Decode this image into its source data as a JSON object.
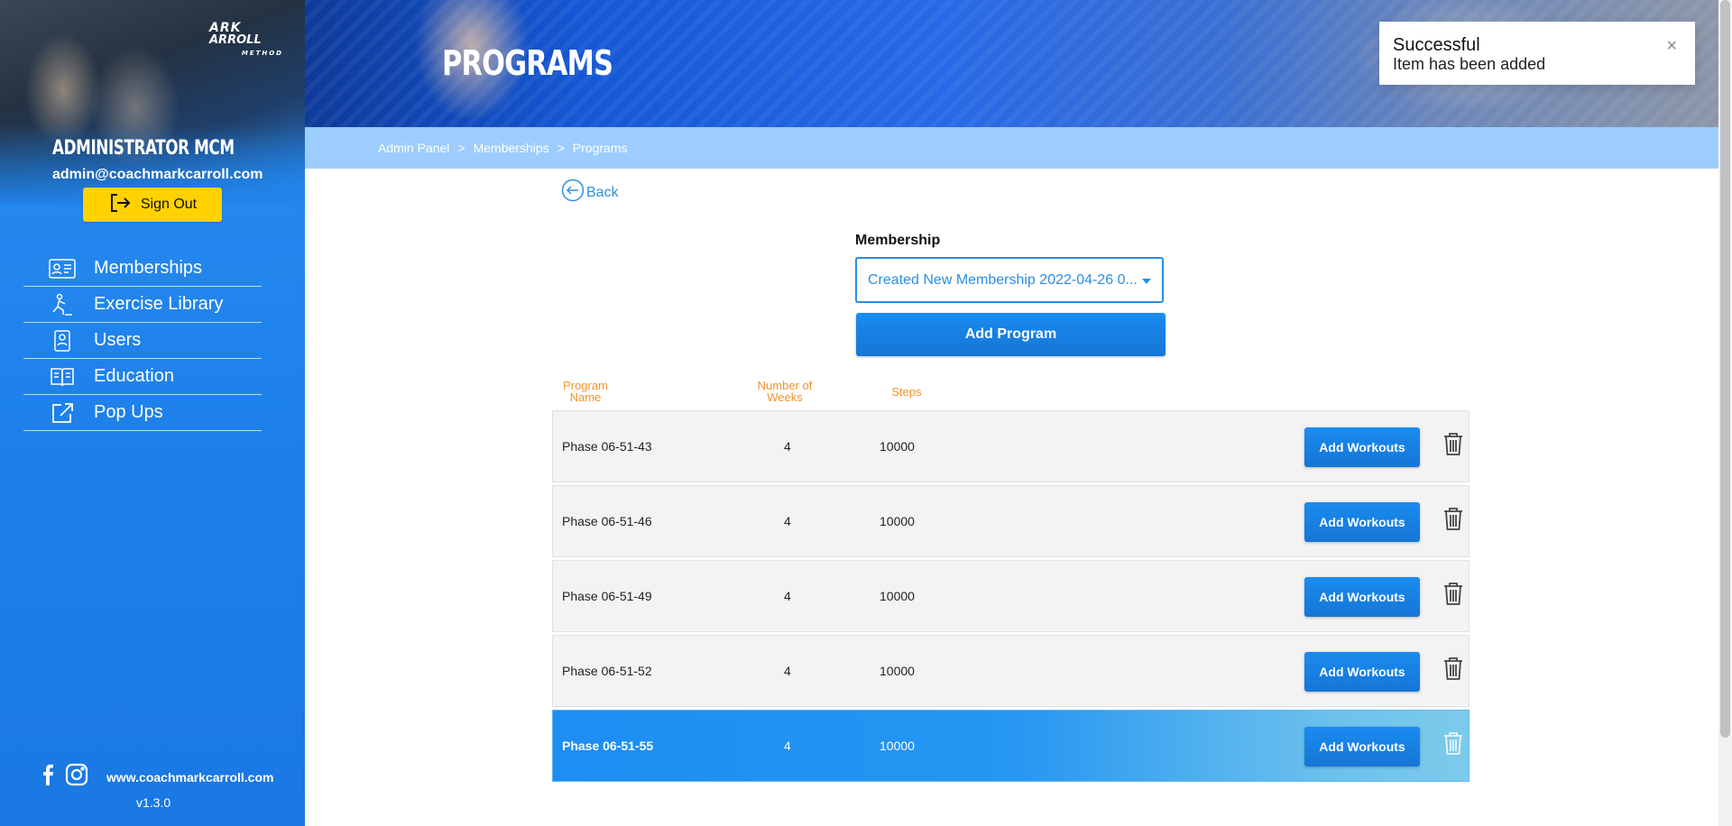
{
  "sidebar": {
    "logo": {
      "line1": "ARK",
      "line2": "ARROLL",
      "line3": "METHOD"
    },
    "admin_name": "ADMINISTRATOR MCM",
    "admin_email": "admin@coachmarkcarroll.com",
    "sign_out_label": "Sign Out",
    "nav": [
      {
        "label": "Memberships",
        "icon": "id-card-icon"
      },
      {
        "label": "Exercise Library",
        "icon": "exercise-icon"
      },
      {
        "label": "Users",
        "icon": "users-icon"
      },
      {
        "label": "Education",
        "icon": "book-icon"
      },
      {
        "label": "Pop Ups",
        "icon": "external-link-icon"
      }
    ],
    "website": "www.coachmarkcarroll.com",
    "version": "v1.3.0"
  },
  "header": {
    "title": "PROGRAMS"
  },
  "breadcrumb": {
    "items": [
      "Admin Panel",
      "Memberships",
      "Programs"
    ],
    "separator": ">"
  },
  "toast": {
    "title": "Successful",
    "message": "Item has been added",
    "close": "×"
  },
  "main": {
    "back_label": "Back",
    "membership_label": "Membership",
    "membership_selected": "Created New Membership 2022-04-26 0...",
    "add_program_label": "Add Program",
    "columns": {
      "name": "Program Name",
      "weeks": "Number of Weeks",
      "steps": "Steps"
    },
    "add_workouts_label": "Add Workouts",
    "rows": [
      {
        "name": "Phase 06-51-43",
        "weeks": "4",
        "steps": "10000"
      },
      {
        "name": "Phase 06-51-46",
        "weeks": "4",
        "steps": "10000"
      },
      {
        "name": "Phase 06-51-49",
        "weeks": "4",
        "steps": "10000"
      },
      {
        "name": "Phase 06-51-52",
        "weeks": "4",
        "steps": "10000"
      },
      {
        "name": "Phase 06-51-55",
        "weeks": "4",
        "steps": "10000"
      }
    ]
  },
  "colors": {
    "accent": "#1a8bf0",
    "sign_out": "#ffd200",
    "header_orange": "#f4922d",
    "breadcrumb_bg": "#9dcdfd"
  }
}
